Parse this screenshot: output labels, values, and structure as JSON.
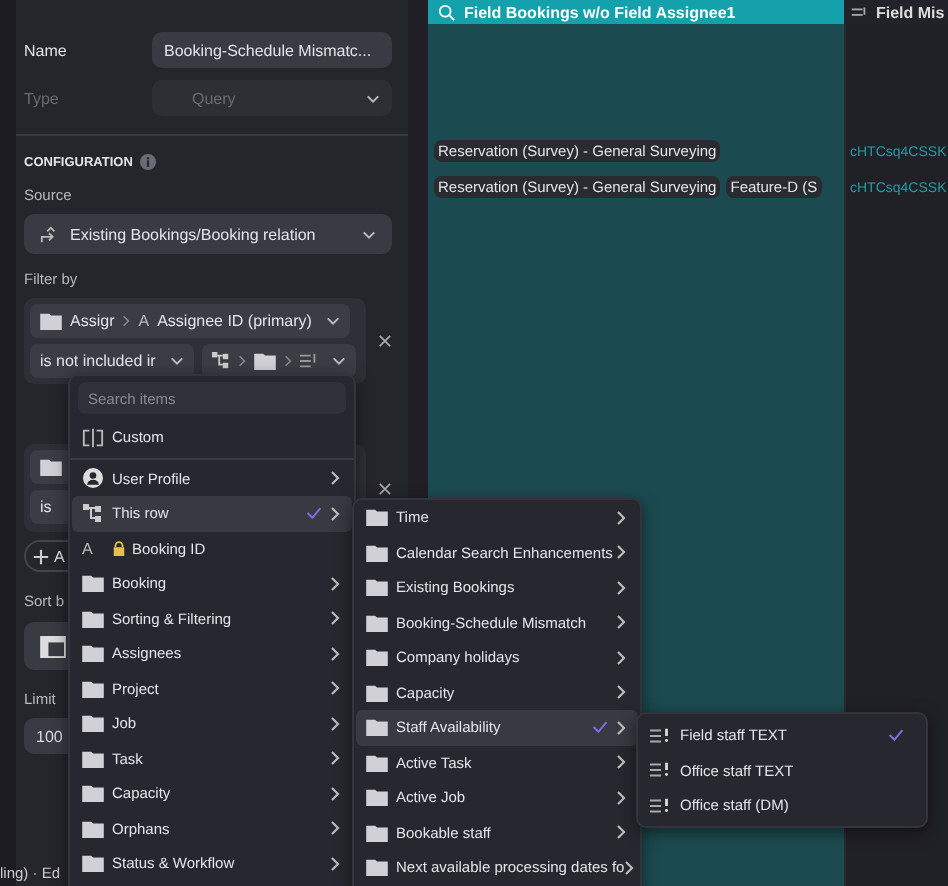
{
  "panel": {
    "name": {
      "label": "Name",
      "value": "Booking-Schedule Mismatc..."
    },
    "type": {
      "label": "Type",
      "value": "Query",
      "disabled": true
    },
    "section": "CONFIGURATION",
    "source": {
      "label": "Source",
      "value": "Existing Bookings/Booking relation"
    },
    "filter_label": "Filter by",
    "filter": {
      "field_parent": "Assigr",
      "field_glyph": "A",
      "field": "Assignee ID (primary)",
      "operator": "is not included ir"
    },
    "filter_2": {
      "operator": "is"
    },
    "add_label": "A",
    "sort_label": "Sort b",
    "limit": {
      "label": "Limit",
      "value": "100"
    }
  },
  "background_fragment": "ling) · Ed",
  "grid": {
    "columns": [
      {
        "title": "Field Bookings w/o Field Assignee1",
        "kind": "query"
      },
      {
        "title": "Field Mis",
        "kind": "field"
      }
    ],
    "rows": [
      {
        "tags": [
          "Reservation (Survey) - General Surveying"
        ],
        "link": "cHTCsq4CSSK"
      },
      {
        "tags": [
          "Reservation (Survey) - General Surveying",
          "Feature-D (S"
        ],
        "link": "cHTCsq4CSSK"
      }
    ]
  },
  "menus": [
    {
      "search_placeholder": "Search items",
      "items": [
        {
          "kind": "custom",
          "label": "Custom",
          "submenu": false,
          "selected": false,
          "checked": false
        },
        {
          "kind": "user",
          "label": "User Profile",
          "submenu": true,
          "selected": false,
          "checked": false
        },
        {
          "kind": "row",
          "label": "This row",
          "submenu": true,
          "selected": true,
          "checked": true
        },
        {
          "kind": "id",
          "glyph": "A",
          "label": "Booking ID",
          "submenu": false,
          "selected": false,
          "checked": false
        },
        {
          "kind": "folder",
          "label": "Booking",
          "submenu": true,
          "selected": false,
          "checked": false
        },
        {
          "kind": "folder",
          "label": "Sorting & Filtering",
          "submenu": true,
          "selected": false,
          "checked": false
        },
        {
          "kind": "folder",
          "label": "Assignees",
          "submenu": true,
          "selected": false,
          "checked": false
        },
        {
          "kind": "folder",
          "label": "Project",
          "submenu": true,
          "selected": false,
          "checked": false
        },
        {
          "kind": "folder",
          "label": "Job",
          "submenu": true,
          "selected": false,
          "checked": false
        },
        {
          "kind": "folder",
          "label": "Task",
          "submenu": true,
          "selected": false,
          "checked": false
        },
        {
          "kind": "folder",
          "label": "Capacity",
          "submenu": true,
          "selected": false,
          "checked": false
        },
        {
          "kind": "folder",
          "label": "Orphans",
          "submenu": true,
          "selected": false,
          "checked": false
        },
        {
          "kind": "folder",
          "label": "Status & Workflow",
          "submenu": true,
          "selected": false,
          "checked": false
        }
      ]
    },
    {
      "items": [
        {
          "kind": "folder",
          "label": "Time",
          "submenu": true,
          "selected": false,
          "checked": false
        },
        {
          "kind": "folder",
          "label": "Calendar Search Enhancements",
          "submenu": true,
          "selected": false,
          "checked": false
        },
        {
          "kind": "folder",
          "label": "Existing Bookings",
          "submenu": true,
          "selected": false,
          "checked": false
        },
        {
          "kind": "folder",
          "label": "Booking-Schedule Mismatch",
          "submenu": true,
          "selected": false,
          "checked": false
        },
        {
          "kind": "folder",
          "label": "Company holidays",
          "submenu": true,
          "selected": false,
          "checked": false
        },
        {
          "kind": "folder",
          "label": "Capacity",
          "submenu": true,
          "selected": false,
          "checked": false
        },
        {
          "kind": "folder",
          "label": "Staff Availability",
          "submenu": true,
          "selected": true,
          "checked": true
        },
        {
          "kind": "folder",
          "label": "Active Task",
          "submenu": true,
          "selected": false,
          "checked": false
        },
        {
          "kind": "folder",
          "label": "Active Job",
          "submenu": true,
          "selected": false,
          "checked": false
        },
        {
          "kind": "folder",
          "label": "Bookable staff",
          "submenu": true,
          "selected": false,
          "checked": false
        },
        {
          "kind": "folder",
          "label": "Next available processing dates fo",
          "submenu": true,
          "selected": false,
          "checked": false
        }
      ]
    },
    {
      "items": [
        {
          "kind": "field",
          "label": "Field staff TEXT",
          "submenu": false,
          "selected": false,
          "checked": true
        },
        {
          "kind": "field",
          "label": "Office staff TEXT",
          "submenu": false,
          "selected": false,
          "checked": false
        },
        {
          "kind": "field",
          "label": "Office staff (DM)",
          "submenu": false,
          "selected": false,
          "checked": false
        }
      ]
    }
  ]
}
